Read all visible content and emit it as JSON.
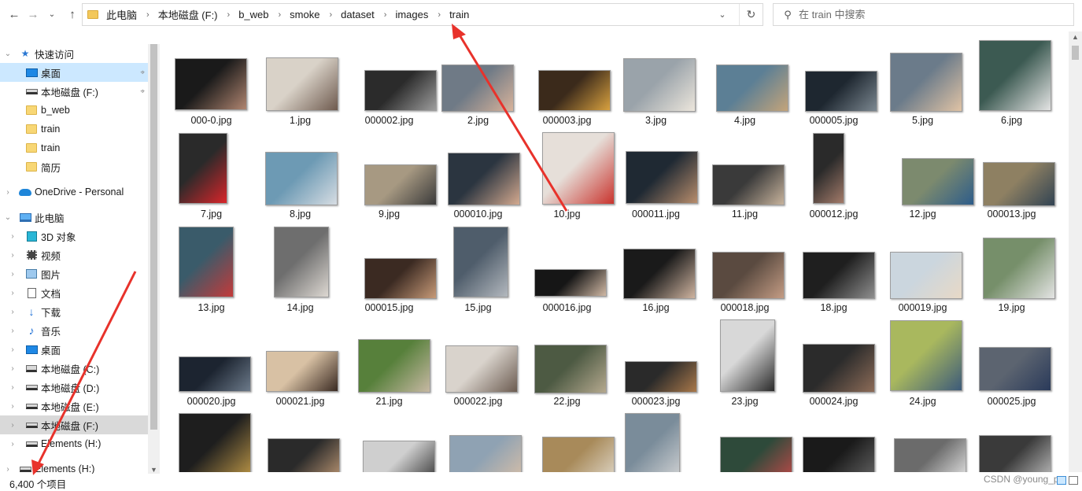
{
  "window": {
    "breadcrumbs": [
      "此电脑",
      "本地磁盘 (F:)",
      "b_web",
      "smoke",
      "dataset",
      "images",
      "train"
    ],
    "search_placeholder": "在 train 中搜索"
  },
  "sidebar": {
    "items": [
      {
        "label": "快速访问",
        "icon": "star-icon",
        "level": 0,
        "expander": "expanded"
      },
      {
        "label": "桌面",
        "icon": "desktop-icon",
        "level": 1,
        "pinned": true,
        "selected": true
      },
      {
        "label": "本地磁盘 (F:)",
        "icon": "drive-icon",
        "level": 1,
        "pinned": true
      },
      {
        "label": "b_web",
        "icon": "folder-icon",
        "level": 1
      },
      {
        "label": "train",
        "icon": "folder-icon",
        "level": 1
      },
      {
        "label": "train",
        "icon": "folder-icon",
        "level": 1
      },
      {
        "label": "简历",
        "icon": "folder-icon",
        "level": 1
      },
      {
        "label": "OneDrive - Personal",
        "icon": "cloud-icon",
        "level": 0,
        "expander": "collapsed"
      },
      {
        "label": "此电脑",
        "icon": "computer-icon",
        "level": 0,
        "expander": "expanded"
      },
      {
        "label": "3D 对象",
        "icon": "cube-icon",
        "level": 1,
        "expander": "collapsed"
      },
      {
        "label": "视频",
        "icon": "video-icon",
        "level": 1,
        "expander": "collapsed"
      },
      {
        "label": "图片",
        "icon": "picture-icon",
        "level": 1,
        "expander": "collapsed"
      },
      {
        "label": "文档",
        "icon": "document-icon",
        "level": 1,
        "expander": "collapsed"
      },
      {
        "label": "下载",
        "icon": "download-icon",
        "level": 1,
        "expander": "collapsed"
      },
      {
        "label": "音乐",
        "icon": "music-icon",
        "level": 1,
        "expander": "collapsed"
      },
      {
        "label": "桌面",
        "icon": "desktop-icon",
        "level": 1,
        "expander": "collapsed"
      },
      {
        "label": "本地磁盘 (C:)",
        "icon": "windows-drive-icon",
        "level": 1,
        "expander": "collapsed"
      },
      {
        "label": "本地磁盘 (D:)",
        "icon": "drive-icon",
        "level": 1,
        "expander": "collapsed"
      },
      {
        "label": "本地磁盘 (E:)",
        "icon": "drive-icon",
        "level": 1,
        "expander": "collapsed"
      },
      {
        "label": "本地磁盘 (F:)",
        "icon": "drive-icon",
        "level": 1,
        "expander": "collapsed",
        "highlighted": true
      },
      {
        "label": "Elements (H:)",
        "icon": "drive-icon",
        "level": 1,
        "expander": "collapsed"
      },
      {
        "label": "Elements (H:)",
        "icon": "drive-icon",
        "level": 0,
        "expander": "collapsed"
      }
    ]
  },
  "files": [
    "000-0.jpg",
    "1.jpg",
    "000002.jpg",
    "2.jpg",
    "000003.jpg",
    "3.jpg",
    "4.jpg",
    "000005.jpg",
    "5.jpg",
    "6.jpg",
    "7.jpg",
    "8.jpg",
    "9.jpg",
    "000010.jpg",
    "10.jpg",
    "000011.jpg",
    "11.jpg",
    "000012.jpg",
    "12.jpg",
    "000013.jpg",
    "13.jpg",
    "14.jpg",
    "000015.jpg",
    "15.jpg",
    "000016.jpg",
    "16.jpg",
    "000018.jpg",
    "18.jpg",
    "000019.jpg",
    "19.jpg",
    "000020.jpg",
    "000021.jpg",
    "21.jpg",
    "000022.jpg",
    "22.jpg",
    "000023.jpg",
    "23.jpg",
    "000024.jpg",
    "24.jpg",
    "000025.jpg",
    "",
    "",
    "",
    "",
    "",
    "",
    "",
    "",
    "",
    ""
  ],
  "status": {
    "item_count": "6,400 个项目",
    "watermark": "CSDN @young_py"
  },
  "colors": {
    "selection": "#cce8ff",
    "annotation_arrow": "#e8322b",
    "accent": "#1e88e5"
  }
}
